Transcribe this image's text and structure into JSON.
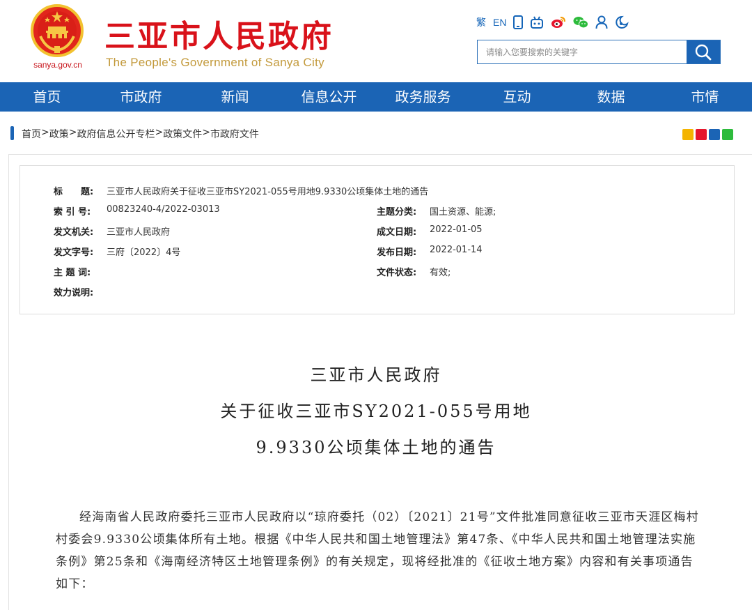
{
  "header": {
    "domain": "sanya.gov.cn",
    "title": "三亚市人民政府",
    "subtitle": "The People's Government of Sanya City",
    "tools": {
      "traditional": "繁",
      "english": "EN"
    },
    "search": {
      "placeholder": "请输入您要搜索的关键字"
    },
    "colors": {
      "brand_red": "#d9121a",
      "brand_blue": "#1b64b5",
      "gold": "#c39a3c"
    }
  },
  "nav": {
    "items": [
      "首页",
      "市政府",
      "新闻",
      "信息公开",
      "政务服务",
      "互动",
      "数据",
      "市情"
    ]
  },
  "breadcrumb": {
    "items": [
      "首页",
      ">",
      "政策",
      ">",
      "政府信息公开专栏",
      ">",
      "政策文件",
      ">",
      "市政府文件"
    ]
  },
  "meta": {
    "title_label": "标　　题:",
    "title_value": "三亚市人民政府关于征收三亚市SY2021-055号用地9.9330公顷集体土地的通告",
    "index_label": "索 引 号:",
    "index_value": "00823240-4/2022-03013",
    "category_label": "主题分类:",
    "category_value": "国土资源、能源;",
    "issuer_label": "发文机关:",
    "issuer_value": "三亚市人民政府",
    "created_label": "成文日期:",
    "created_value": "2022-01-05",
    "docno_label": "发文字号:",
    "docno_value": "三府〔2022〕4号",
    "published_label": "发布日期:",
    "published_value": "2022-01-14",
    "keywords_label": "主 题 词:",
    "keywords_value": "",
    "status_label": "文件状态:",
    "status_value": "有效;",
    "validity_label": "效力说明:",
    "validity_value": ""
  },
  "document": {
    "title_line1": "三亚市人民政府",
    "title_line2": "关于征收三亚市SY2021-055号用地",
    "title_line3": "9.9330公顷集体土地的通告",
    "paragraph1": "经海南省人民政府委托三亚市人民政府以“琼府委托（02）〔2021〕21号”文件批准同意征收三亚市天涯区梅村村委会9.9330公顷集体所有土地。根据《中华人民共和国土地管理法》第47条、《中华人民共和国土地管理法实施条例》第25条和《海南经济特区土地管理条例》的有关规定，现将经批准的《征收土地方案》内容和有关事项通告如下："
  }
}
